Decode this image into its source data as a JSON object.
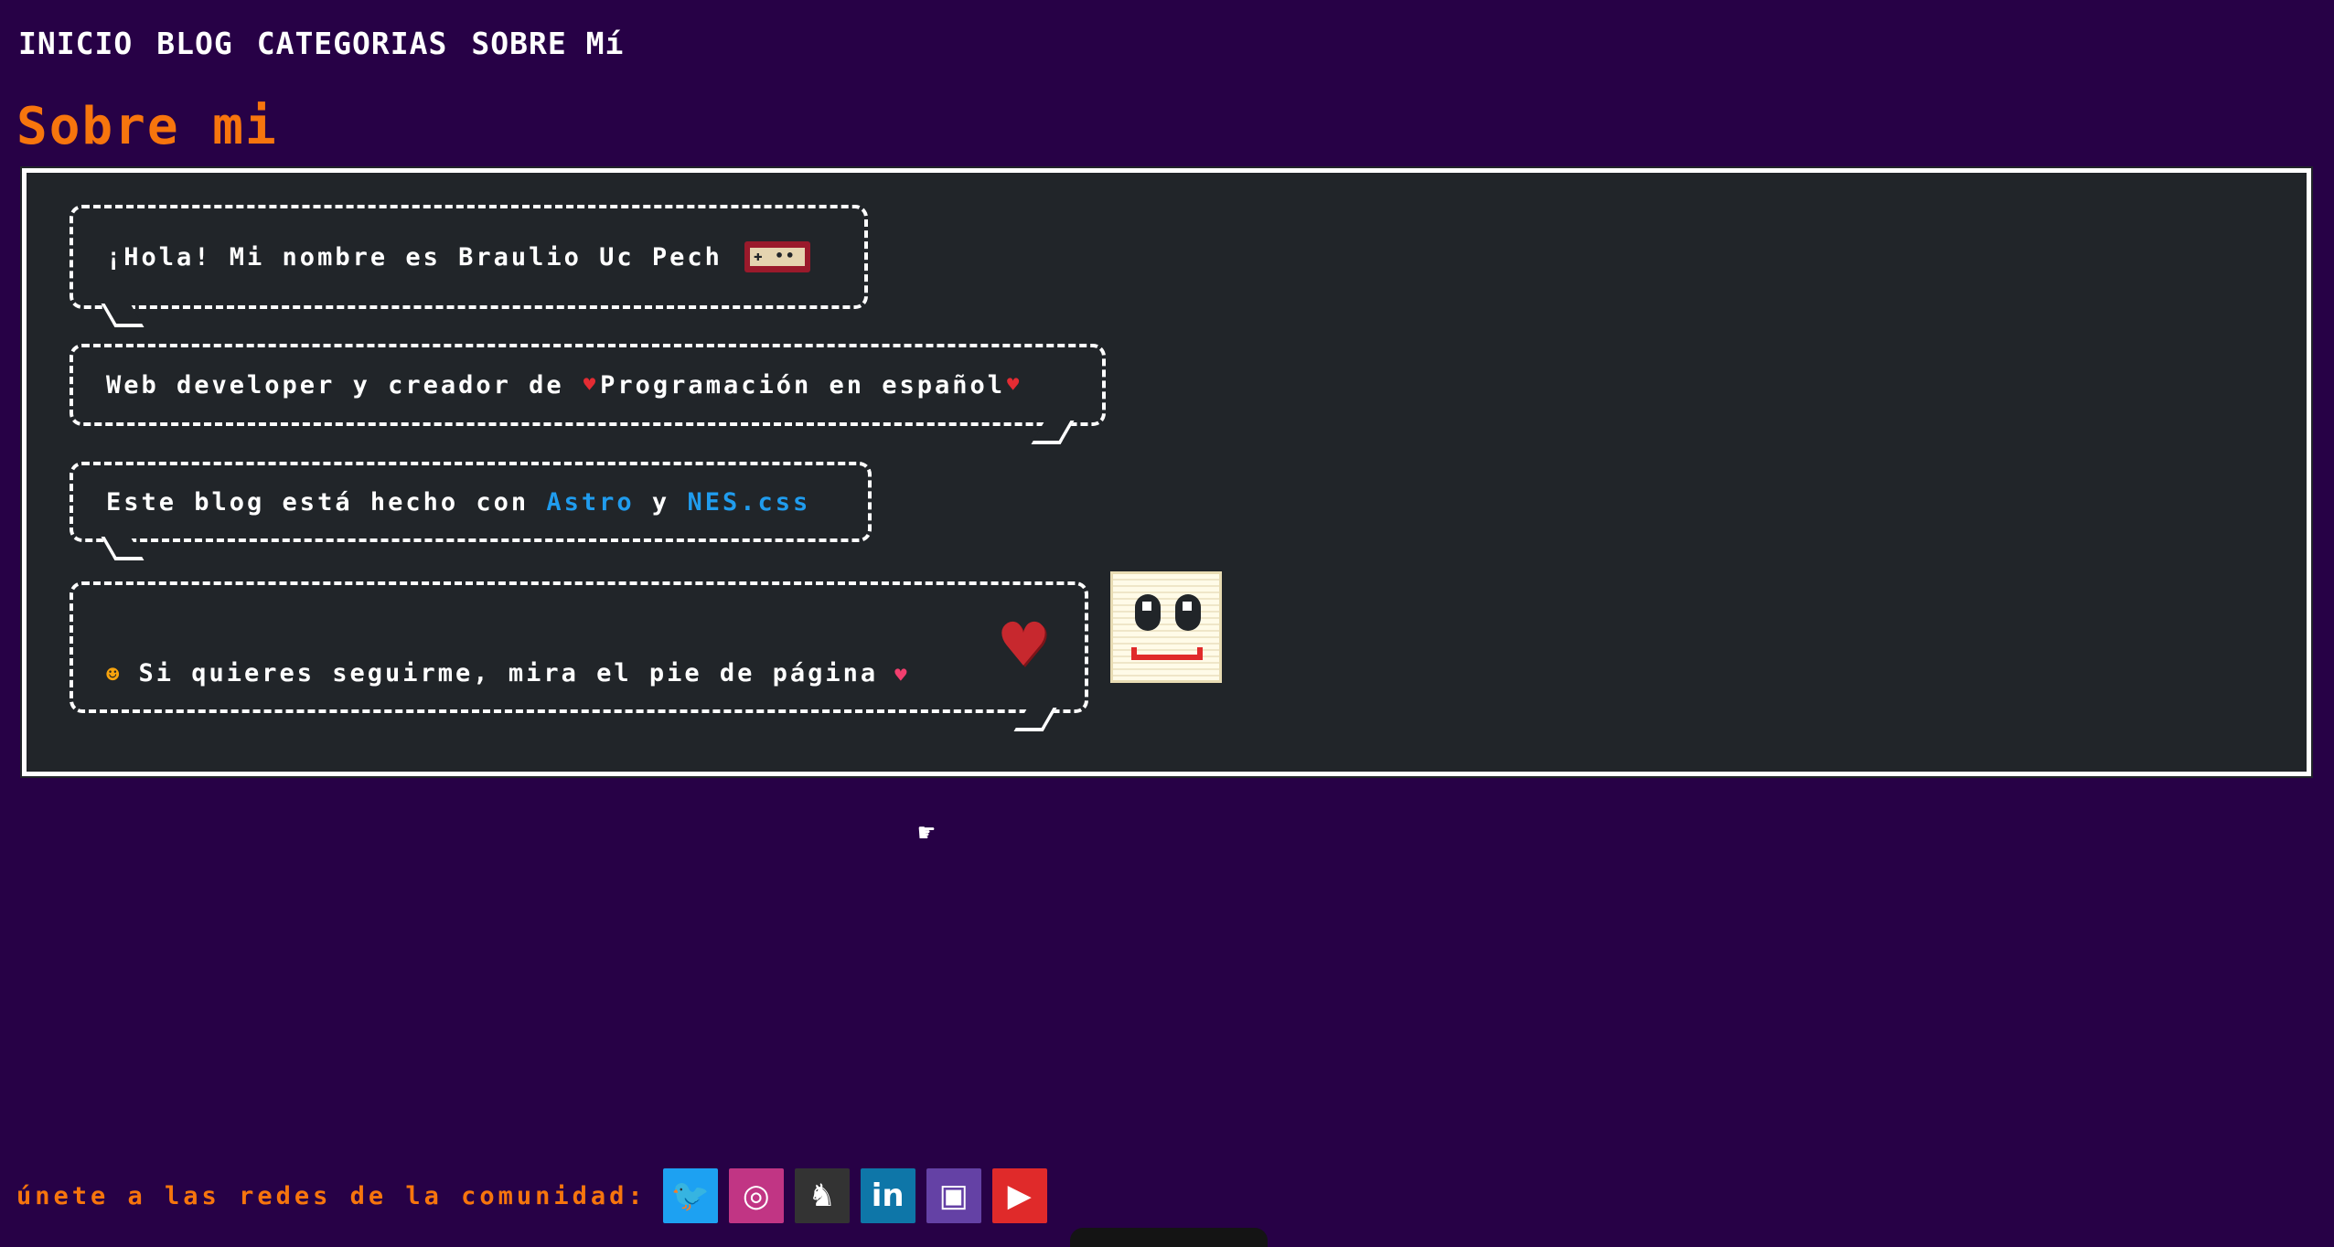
{
  "nav": {
    "items": [
      "INICIO",
      "BLOG",
      "CATEGORIAS",
      "SOBRE Mí"
    ]
  },
  "page_title": "Sobre mi",
  "balloons": {
    "b1": {
      "text": "¡Hola! Mi nombre es Braulio Uc Pech",
      "icon": "controller-icon"
    },
    "b2": {
      "prefix": "Web developer y creador de ",
      "heart": "♥",
      "highlight": "Programación en español",
      "heart2": "♥"
    },
    "b3": {
      "prefix": "Este blog está hecho con ",
      "link1": "Astro",
      "middle": " y ",
      "link2": "NES.css"
    },
    "b4": {
      "smile": "☻",
      "text": "Si quieres seguirme, mira el pie de página",
      "heart": "♥",
      "big_heart": "♥"
    }
  },
  "footer": {
    "label": "únete a las redes de la comunidad:",
    "socials": [
      {
        "name": "twitter",
        "glyph": "🐦"
      },
      {
        "name": "instagram",
        "glyph": "◎"
      },
      {
        "name": "github",
        "glyph": "♞"
      },
      {
        "name": "linkedin",
        "glyph": "in"
      },
      {
        "name": "twitch",
        "glyph": "▣"
      },
      {
        "name": "youtube",
        "glyph": "▶"
      }
    ]
  },
  "colors": {
    "background": "#270146",
    "panel": "#212529",
    "accent": "#f7750d",
    "link": "#209cee"
  }
}
